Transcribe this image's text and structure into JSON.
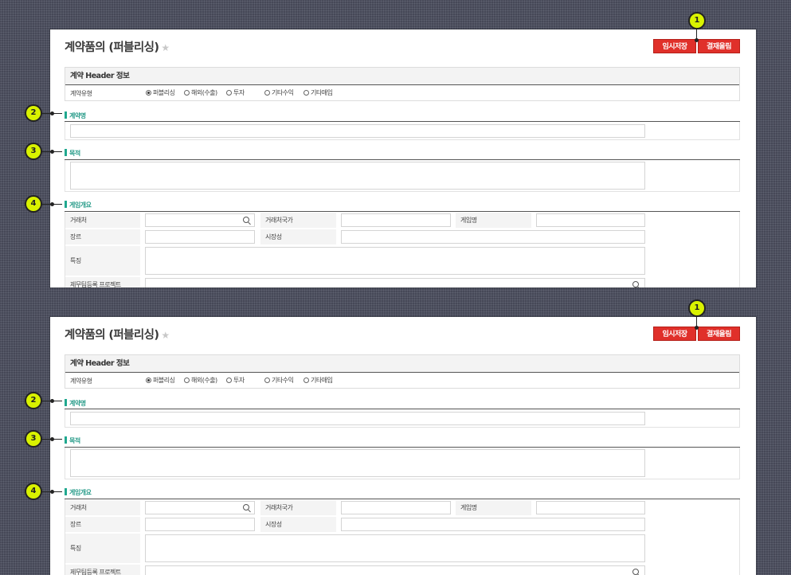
{
  "title": "계약품의 (퍼블리싱)",
  "star": "★",
  "buttons": {
    "temp_save": "임시저장",
    "approve": "결재올림"
  },
  "header_section": {
    "title": "계약 Header 정보",
    "contract_type_label": "계약유형",
    "options": [
      {
        "label": "퍼블리싱",
        "selected": true
      },
      {
        "label": "해외(수출)",
        "selected": false
      },
      {
        "label": "투자",
        "selected": false
      },
      {
        "label": "기타수익",
        "selected": false
      },
      {
        "label": "기타매입",
        "selected": false
      }
    ]
  },
  "sections": {
    "contract_name": "계약명",
    "purpose": "목적",
    "game_overview": "게임개요"
  },
  "overview_fields": {
    "client": "거래처",
    "client_country": "거래처국가",
    "game_name": "게임명",
    "genre": "장르",
    "marketability": "시장성",
    "features": "특징",
    "project": "제무팀등록 프로젝트"
  },
  "badges": [
    "1",
    "2",
    "3",
    "4"
  ],
  "colors": {
    "button": "#e0302a",
    "section_accent": "#20a88f",
    "badge": "#d9f200"
  }
}
